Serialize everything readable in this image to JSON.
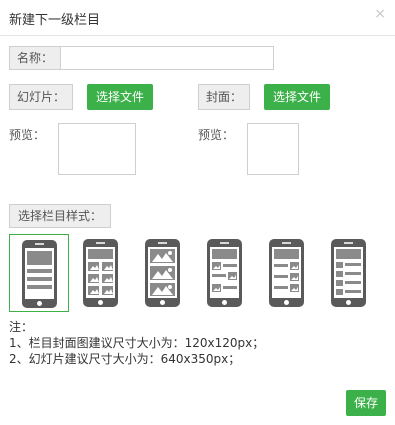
{
  "dialog": {
    "title": "新建下一级栏目",
    "close_icon": "close-icon",
    "close_glyph": "×"
  },
  "name_field": {
    "label": "名称：",
    "value": "",
    "placeholder": ""
  },
  "slideshow": {
    "label": "幻灯片：",
    "button_label": "选择文件",
    "preview_label": "预览："
  },
  "cover": {
    "label": "封面：",
    "button_label": "选择文件",
    "preview_label": "预览："
  },
  "layout_style": {
    "button_label": "选择栏目样式：",
    "options": [
      {
        "icon": "phone-layout-list-icon",
        "selected": true
      },
      {
        "icon": "phone-layout-grid-icon",
        "selected": false
      },
      {
        "icon": "phone-layout-gallery-icon",
        "selected": false
      },
      {
        "icon": "phone-layout-mixed-icon",
        "selected": false
      },
      {
        "icon": "phone-layout-thumb-list-icon",
        "selected": false
      },
      {
        "icon": "phone-layout-text-list-icon",
        "selected": false
      }
    ]
  },
  "notes": {
    "heading": "注：",
    "line1": "1、栏目封面图建议尺寸大小为：120x120px；",
    "line2": "2、幻灯片建议尺寸大小为：640x350px；"
  },
  "footer": {
    "save_label": "保存"
  },
  "colors": {
    "accent_green": "#3cb14a",
    "phone_body": "#5a5a5a",
    "addon_bg": "#eeeeee",
    "border": "#cfcfcf"
  }
}
